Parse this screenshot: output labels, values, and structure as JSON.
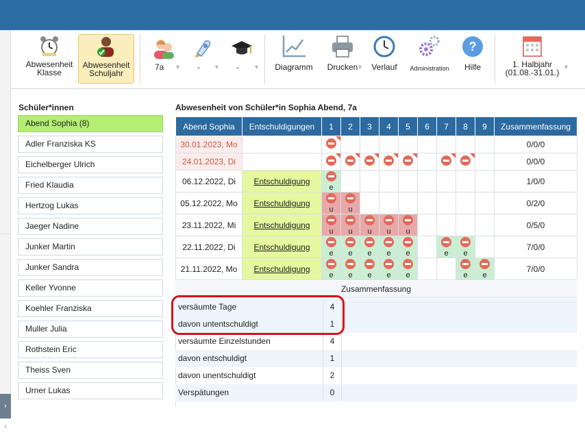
{
  "toolbar": {
    "abs_class_line1": "Abwesenheit",
    "abs_class_line2": "Klasse",
    "abs_year_line1": "Abwesenheit",
    "abs_year_line2": "Schuljahr",
    "class_value": "7a",
    "dd2_value": "-",
    "dd3_value": "-",
    "diagramm": "Diagramm",
    "drucken": "Drucken",
    "verlauf": "Verlauf",
    "administration": "Administration",
    "hilfe": "Hilfe",
    "period_line1": "1. Halbjahr",
    "period_line2": "(01.08.-31.01.)"
  },
  "sidebar": {
    "title": "Schüler*innen",
    "students": [
      "Abend Sophia (8)",
      "Adler Franziska KS",
      "Eichelberger Ulrich",
      "Fried Klaudia",
      "Hertzog Lukas",
      "Jaeger Nadine",
      "Junker Martin",
      "Junker Sandra",
      "Keller Yvonne",
      "Koehler Franziska",
      "Muller Julia",
      "Rothstein Eric",
      "Theiss Sven",
      "Urner Lukas"
    ]
  },
  "main": {
    "heading": "Abwesenheit von Schüler*in Sophia Abend, 7a",
    "columns": [
      "Abend Sophia",
      "Entschuldigungen",
      "1",
      "2",
      "3",
      "4",
      "5",
      "6",
      "7",
      "8",
      "9",
      "Zusammenfassung"
    ],
    "rows": [
      {
        "date": "30.01.2023, Mo",
        "ent": "",
        "summary": "0/0/0"
      },
      {
        "date": "24.01.2023, Di",
        "ent": "",
        "summary": "0/0/0"
      },
      {
        "date": "06.12.2022, Di",
        "ent": "Entschuldigung",
        "summary": "1/0/0"
      },
      {
        "date": "05.12.2022, Mo",
        "ent": "Entschuldigung",
        "summary": "0/2/0"
      },
      {
        "date": "23.11.2022, Mi",
        "ent": "Entschuldigung",
        "summary": "0/5/0"
      },
      {
        "date": "22.11.2022, Di",
        "ent": "Entschuldigung",
        "summary": "7/0/0"
      },
      {
        "date": "21.11.2022, Mo",
        "ent": "Entschuldigung",
        "summary": "7/0/0"
      }
    ],
    "letters": {
      "e": "e",
      "u": "u"
    },
    "summary_title": "Zusammenfassung",
    "summary_rows": [
      {
        "label": "versäumte Tage",
        "value": "4"
      },
      {
        "label": "davon untentschuldigt",
        "value": "1"
      },
      {
        "label": "versäumte Einzelstunden",
        "value": "4"
      },
      {
        "label": "davon entschuldigt",
        "value": "1"
      },
      {
        "label": "davon unentschuldigt",
        "value": "2"
      },
      {
        "label": "Verspätungen",
        "value": "0"
      }
    ]
  },
  "colors": {
    "header": "#2c6aa0",
    "selected": "#b4ee72",
    "excused": "#cbedd2",
    "unexcused": "#e7a8a8",
    "marker": "#e26a5a",
    "highlight": "#d6111b"
  }
}
